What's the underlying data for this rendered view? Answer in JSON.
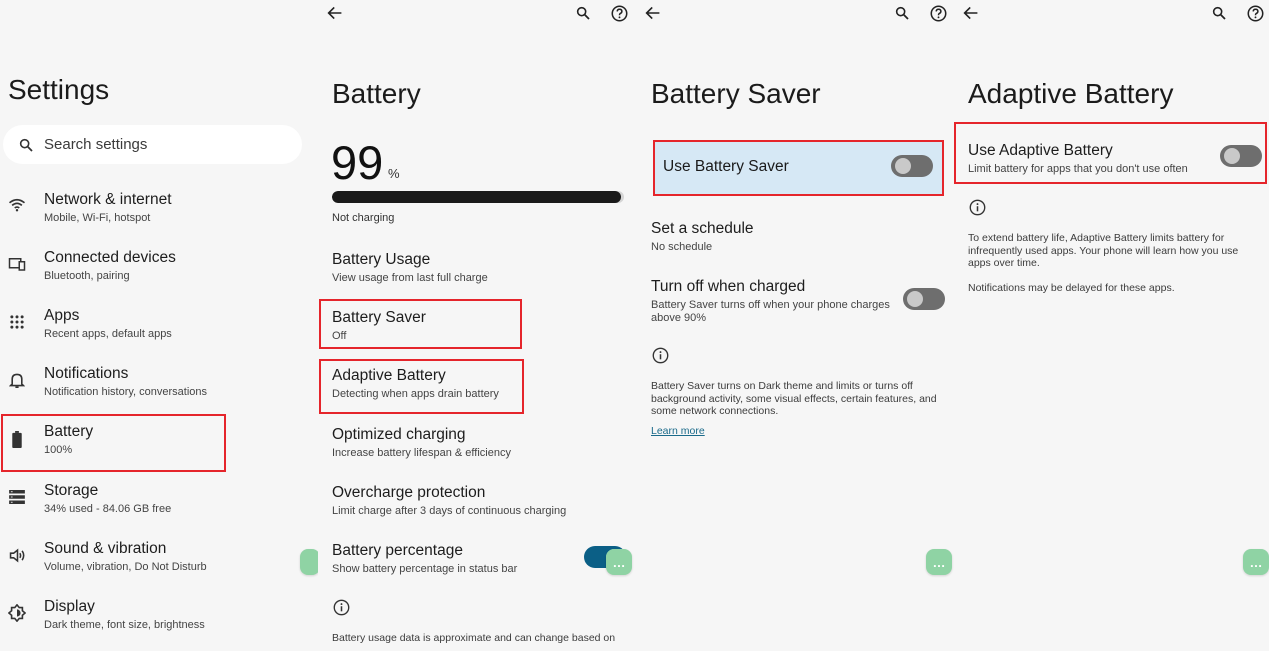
{
  "settings": {
    "title": "Settings",
    "search_placeholder": "Search settings",
    "items": [
      {
        "title": "Network & internet",
        "sub": "Mobile, Wi-Fi, hotspot"
      },
      {
        "title": "Connected devices",
        "sub": "Bluetooth, pairing"
      },
      {
        "title": "Apps",
        "sub": "Recent apps, default apps"
      },
      {
        "title": "Notifications",
        "sub": "Notification history, conversations"
      },
      {
        "title": "Battery",
        "sub": "100%"
      },
      {
        "title": "Storage",
        "sub": "34% used - 84.06 GB free"
      },
      {
        "title": "Sound & vibration",
        "sub": "Volume, vibration, Do Not Disturb"
      },
      {
        "title": "Display",
        "sub": "Dark theme, font size, brightness"
      }
    ]
  },
  "battery": {
    "title": "Battery",
    "level": "99",
    "unit": "%",
    "level_fraction": 0.99,
    "status": "Not charging",
    "items": [
      {
        "title": "Battery Usage",
        "sub": "View usage from last full charge"
      },
      {
        "title": "Battery Saver",
        "sub": "Off"
      },
      {
        "title": "Adaptive Battery",
        "sub": "Detecting when apps drain battery"
      },
      {
        "title": "Optimized charging",
        "sub": "Increase battery lifespan & efficiency"
      },
      {
        "title": "Overcharge protection",
        "sub": "Limit charge after 3 days of continuous charging"
      },
      {
        "title": "Battery percentage",
        "sub": "Show battery percentage in status bar"
      }
    ],
    "footer": "Battery usage data is approximate and can change based on"
  },
  "saver": {
    "title": "Battery Saver",
    "use_label": "Use Battery Saver",
    "schedule_title": "Set a schedule",
    "schedule_sub": "No schedule",
    "turnoff_title": "Turn off when charged",
    "turnoff_sub_1": "Battery Saver turns off when your phone charges",
    "turnoff_sub_2": "above 90%",
    "info_1": "Battery Saver turns on Dark theme and limits or turns off",
    "info_2": "background activity, some visual effects, certain features, and",
    "info_3": "some network connections.",
    "learn_more": "Learn more"
  },
  "adaptive": {
    "title": "Adaptive Battery",
    "use_label": "Use Adaptive Battery",
    "use_sub": "Limit battery for apps that you don't use often",
    "info_1": "To extend battery life, Adaptive Battery limits battery for",
    "info_2": "infrequently used apps. Your phone will learn how you use",
    "info_3": "apps over time.",
    "info_4": "Notifications may be delayed for these apps."
  },
  "fab_label": "…",
  "colors": {
    "highlight": "#e5252b",
    "toggle_on": "#0b5f86",
    "saver_bg": "#d6e8f5",
    "fab": "#8fd3a4"
  }
}
